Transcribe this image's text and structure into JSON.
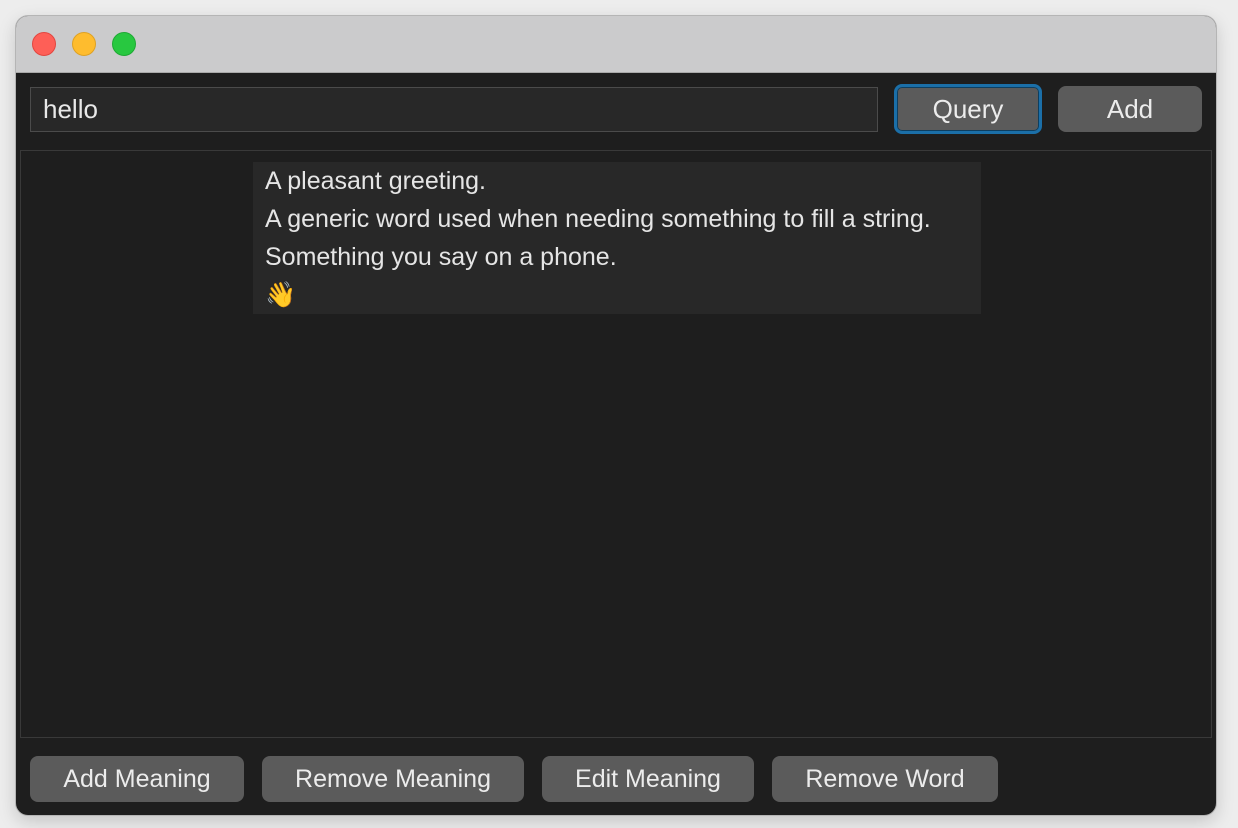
{
  "window": {
    "controls": [
      "close",
      "minimize",
      "zoom"
    ]
  },
  "search": {
    "value": "hello"
  },
  "toolbar": {
    "query_label": "Query",
    "add_label": "Add"
  },
  "meanings": [
    "A pleasant greeting.",
    "A generic word used when needing something to fill a string.",
    "Something you say on a phone.",
    "👋"
  ],
  "bottom_bar": {
    "add_meaning_label": "Add Meaning",
    "remove_meaning_label": "Remove Meaning",
    "edit_meaning_label": "Edit Meaning",
    "remove_word_label": "Remove Word"
  },
  "colors": {
    "background": "#1e1e1e",
    "titlebar": "#cbcbcc",
    "button": "#5b5b5b",
    "focus_ring": "#1b6fa8",
    "close": "#fe5f57",
    "minimize": "#febc2e",
    "zoom": "#28c840"
  }
}
